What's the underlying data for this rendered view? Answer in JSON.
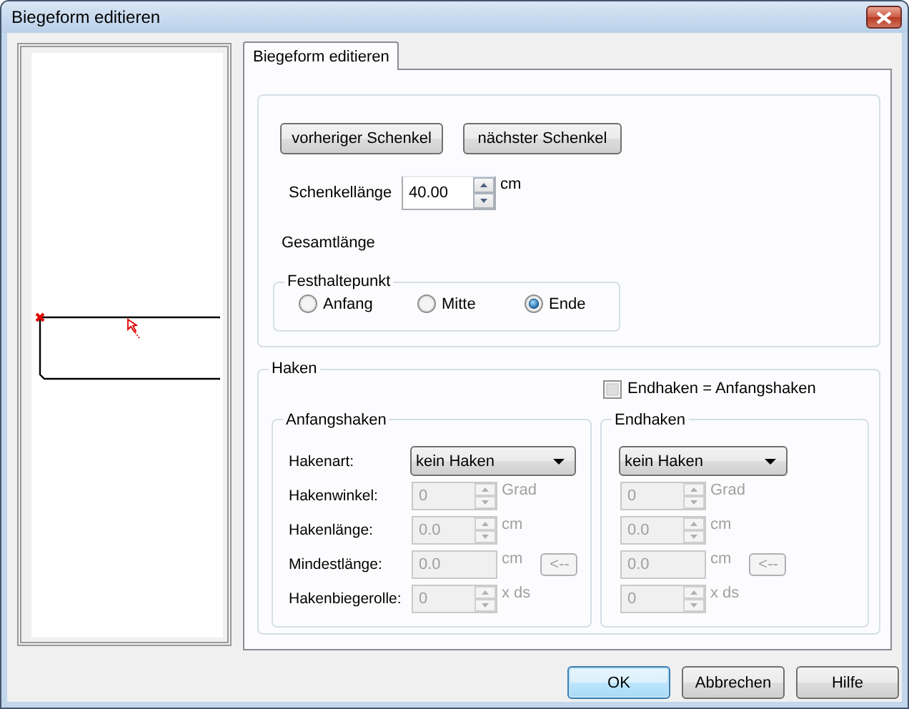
{
  "window": {
    "title": "Biegeform editieren"
  },
  "tabs": [
    {
      "label": "Biegeform editieren",
      "selected": true
    }
  ],
  "leg_buttons": [
    "vorheriger Schenkel",
    "nächster Schenkel"
  ],
  "leg_length": {
    "label": "Schenkellänge",
    "value": "40.00",
    "unit": "cm"
  },
  "total_length": {
    "label": "Gesamtlänge"
  },
  "anchor_point": {
    "title": "Festhaltepunkt",
    "options": [
      {
        "label": "Anfang",
        "selected": false
      },
      {
        "label": "Mitte",
        "selected": false
      },
      {
        "label": "Ende",
        "selected": true
      }
    ]
  },
  "hooks": {
    "title": "Haken",
    "same_hooks": {
      "label": "Endhaken = Anfangshaken",
      "checked": false
    },
    "start_hook": {
      "title": "Anfangshaken",
      "rows": [
        {
          "kind": "dropdown",
          "label": "Hakenart:",
          "value": "kein Haken",
          "disabled": false
        },
        {
          "kind": "spin",
          "label": "Hakenwinkel:",
          "value": "0",
          "unit": "Grad",
          "disabled": true
        },
        {
          "kind": "spin",
          "label": "Hakenlänge:",
          "value": "0.0",
          "unit": "cm",
          "disabled": true
        },
        {
          "kind": "field_button",
          "label": "Mindestlänge:",
          "value": "0.0",
          "unit": "cm",
          "button": "<--",
          "disabled": true
        },
        {
          "kind": "spin",
          "label": "Hakenbiegerolle:",
          "value": "0",
          "unit": "x ds",
          "disabled": true
        }
      ]
    },
    "end_hook": {
      "title": "Endhaken",
      "rows": [
        {
          "kind": "dropdown",
          "value": "kein Haken",
          "disabled": false
        },
        {
          "kind": "spin",
          "value": "0",
          "unit": "Grad",
          "disabled": true
        },
        {
          "kind": "spin",
          "value": "0.0",
          "unit": "cm",
          "disabled": true
        },
        {
          "kind": "field_button",
          "value": "0.0",
          "unit": "cm",
          "button": "<--",
          "disabled": true
        },
        {
          "kind": "spin",
          "value": "0",
          "unit": "x ds",
          "disabled": true
        }
      ]
    }
  },
  "buttons": [
    {
      "label": "OK",
      "default": true
    },
    {
      "label": "Abbrechen",
      "default": false
    },
    {
      "label": "Hilfe",
      "default": false
    }
  ]
}
